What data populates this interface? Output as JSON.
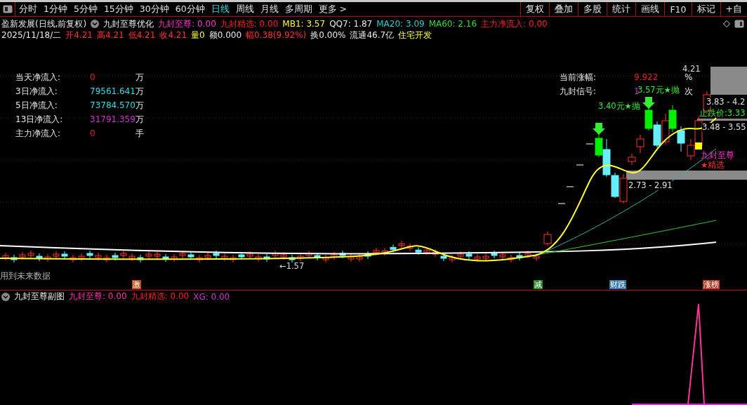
{
  "toolbar": {
    "periods": [
      {
        "label": "分时",
        "selected": false
      },
      {
        "label": "1分钟",
        "selected": false
      },
      {
        "label": "5分钟",
        "selected": false
      },
      {
        "label": "15分钟",
        "selected": false
      },
      {
        "label": "30分钟",
        "selected": false
      },
      {
        "label": "60分钟",
        "selected": false
      },
      {
        "label": "日线",
        "selected": true
      },
      {
        "label": "周线",
        "selected": false
      },
      {
        "label": "月线",
        "selected": false
      },
      {
        "label": "多周期",
        "selected": false
      },
      {
        "label": "更多 >",
        "selected": false
      }
    ],
    "tools": [
      "复权",
      "叠加",
      "多股",
      "统计",
      "画线",
      "F10",
      "标记",
      "+自"
    ]
  },
  "legend": {
    "title": "盈新发展(日线,前复权)",
    "indicator": "九封至尊优化",
    "values": [
      {
        "text": "九封至尊: 0.00",
        "color": "#ff33cc"
      },
      {
        "text": "九封精选: 0.00",
        "color": "#ff2020"
      },
      {
        "text": "MB1: 3.57",
        "color": "#ffff33"
      },
      {
        "text": "QQ7: 1.87",
        "color": "#e8e8e8"
      },
      {
        "text": "MA20: 3.09",
        "color": "#33cccc"
      },
      {
        "text": "MA60: 2.16",
        "color": "#33dd33"
      },
      {
        "text": "主力净流入: 0.00",
        "color": "#ff2020"
      }
    ]
  },
  "quote": {
    "date": "2025/11/18/二",
    "fields": [
      {
        "text": "开4.21",
        "color": "#ff3030"
      },
      {
        "text": "高4.21",
        "color": "#ff3030"
      },
      {
        "text": "低4.21",
        "color": "#ff3030"
      },
      {
        "text": "收4.21",
        "color": "#ff3030"
      },
      {
        "text": "量0",
        "color": "#ffff33"
      },
      {
        "text": "额0.000",
        "color": "#e8e8e8"
      },
      {
        "text": "幅0.38(9.92%)",
        "color": "#ff3030"
      },
      {
        "text": "换0.00%",
        "color": "#e8e8e8"
      },
      {
        "text": "流通46.7亿",
        "color": "#e8e8e8"
      },
      {
        "text": "住宅开发",
        "color": "#ffff33"
      }
    ]
  },
  "flows": [
    {
      "label": "当天净流入:",
      "value": "0",
      "unit": "万",
      "color": "#e02020"
    },
    {
      "label": "3日净流入:",
      "value": "79561.641",
      "unit": "万",
      "color": "#33dddd"
    },
    {
      "label": "5日净流入:",
      "value": "73784.570",
      "unit": "万",
      "color": "#33dddd"
    },
    {
      "label": "13日净流入:",
      "value": "31791.359",
      "unit": "万",
      "color": "#cc33cc"
    },
    {
      "label": "主力净流入:",
      "value": "0",
      "unit": "手",
      "color": "#e02020"
    }
  ],
  "signals": [
    {
      "label": "当前涨幅:",
      "value": "9.922",
      "unit": "%",
      "color": "#e02020"
    },
    {
      "label": "九封信号:",
      "value": "1",
      "unit": "次",
      "color": "#cc33cc"
    }
  ],
  "chart_labels": [
    {
      "text": "4.21",
      "kind": "price"
    },
    {
      "text": "3.40元★抛",
      "kind": "sell"
    },
    {
      "text": "3.57元★抛",
      "kind": "sell"
    },
    {
      "text": "3.83 - 4.2",
      "kind": "range"
    },
    {
      "text": "止跌价:3.33",
      "kind": "stop"
    },
    {
      "text": "3.48 - 3.55",
      "kind": "range"
    },
    {
      "text": "2.73 - 2.91",
      "kind": "range"
    },
    {
      "text": "九封至尊",
      "kind": "signal"
    },
    {
      "text": "★精选",
      "kind": "pick"
    },
    {
      "text": "←1.57",
      "kind": "price"
    }
  ],
  "note": "用到未来数据",
  "markers": [
    {
      "text": "激",
      "color": "#c0501a"
    },
    {
      "text": "减",
      "color": "#2a8a2a"
    },
    {
      "text": "财跌",
      "color": "#3a7aa8"
    },
    {
      "text": "涨榜",
      "color": "#b83a2a"
    }
  ],
  "sub_chart": {
    "title": "九封至尊副图",
    "values": [
      {
        "text": "九封至尊: 0.00",
        "color": "#ff33aa"
      },
      {
        "text": "九封精选: 0.00",
        "color": "#ff2020"
      },
      {
        "text": "XG: 0.00",
        "color": "#cc33cc"
      }
    ]
  }
}
